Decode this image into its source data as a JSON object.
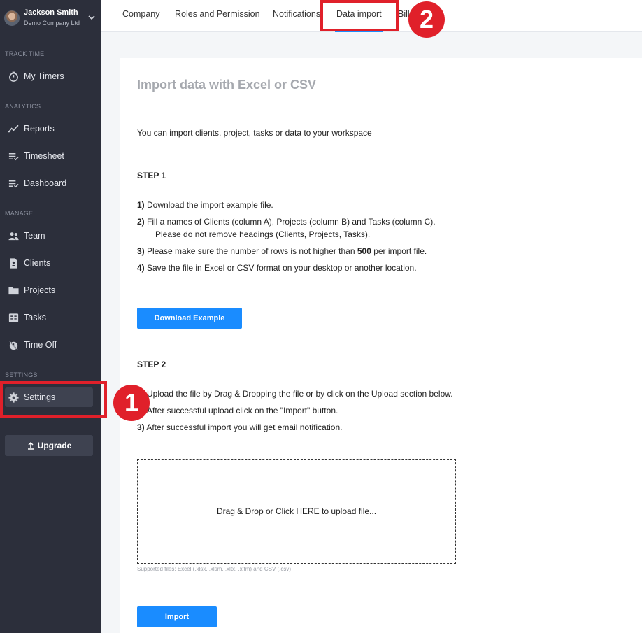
{
  "user": {
    "name": "Jackson Smith",
    "company": "Demo Company Ltd"
  },
  "sidebar": {
    "sections": {
      "track_time": "TRACK TIME",
      "analytics": "ANALYTICS",
      "manage": "MANAGE",
      "settings": "SETTINGS"
    },
    "items": [
      {
        "label": "My Timers",
        "icon": "stopwatch-icon"
      },
      {
        "label": "Reports",
        "icon": "trend-chart-icon"
      },
      {
        "label": "Timesheet",
        "icon": "list-check-icon"
      },
      {
        "label": "Dashboard",
        "icon": "list-check-icon"
      },
      {
        "label": "Team",
        "icon": "people-icon"
      },
      {
        "label": "Clients",
        "icon": "contact-card-icon"
      },
      {
        "label": "Projects",
        "icon": "folder-icon"
      },
      {
        "label": "Tasks",
        "icon": "task-board-icon"
      },
      {
        "label": "Time Off",
        "icon": "time-off-icon"
      },
      {
        "label": "Settings",
        "icon": "gear-icon",
        "active": true
      }
    ],
    "upgrade_label": "Upgrade"
  },
  "tabs": [
    {
      "label": "Company"
    },
    {
      "label": "Roles and Permission"
    },
    {
      "label": "Notifications"
    },
    {
      "label": "Data import",
      "active": true
    },
    {
      "label": "Bill"
    }
  ],
  "content": {
    "title": "Import data with Excel or CSV",
    "intro": "You can import clients, project, tasks or data to your workspace",
    "step1": {
      "title": "STEP 1",
      "lines": [
        {
          "num": "1)",
          "text": " Download the import example file."
        },
        {
          "num": "2)",
          "text": " Fill a names of Clients (column A), Projects (column B) and Tasks (column C)."
        },
        {
          "num": "",
          "text": "Please do not remove headings (Clients, Projects, Tasks)."
        },
        {
          "num": "3)",
          "text": " Please make sure the number of rows is not higher than ",
          "bold": "500",
          "after": " per import file."
        },
        {
          "num": "4)",
          "text": " Save the file in Excel or CSV format on your desktop or another location."
        }
      ],
      "download_button": "Download Example"
    },
    "step2": {
      "title": "STEP 2",
      "lines": [
        {
          "num": "",
          "text": "Upload the file by Drag & Dropping the file or by click on the Upload section below."
        },
        {
          "num": "",
          "text": "After successful upload click on the \"Import\" button."
        },
        {
          "num": "3)",
          "text": " After successful import you will get email notification."
        }
      ],
      "dropzone_text": "Drag & Drop or Click HERE to upload file...",
      "supported": "Supported files: Excel (.xlsx, .xlsm, .xltx, .xltm) and CSV (.csv)",
      "import_button": "Import"
    }
  },
  "annotations": {
    "marker1": "1",
    "marker2": "2"
  },
  "colors": {
    "sidebar": "#2c2f3b",
    "accent": "#1a8cff",
    "annotation": "#e0202a"
  }
}
